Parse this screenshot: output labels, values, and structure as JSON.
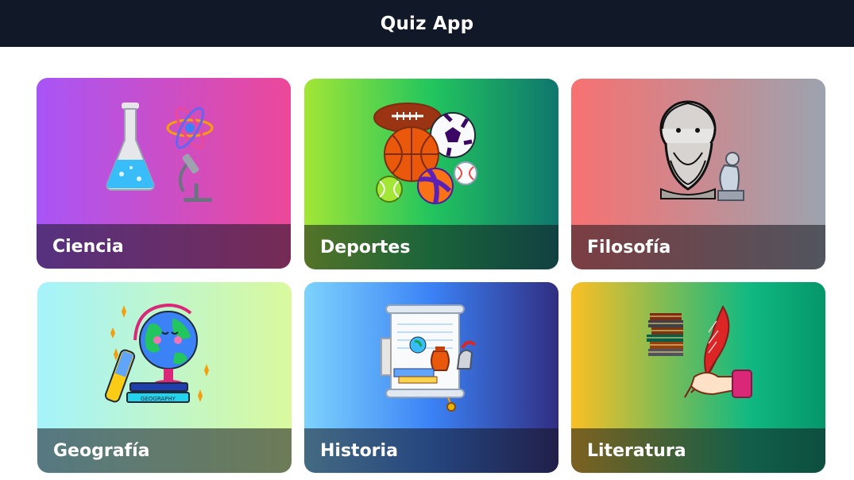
{
  "header": {
    "title": "Quiz App",
    "background": "#111827"
  },
  "categories": [
    {
      "label": "Ciencia",
      "icon": "science-flask-atom-microscope-icon"
    },
    {
      "label": "Deportes",
      "icon": "sports-balls-icon"
    },
    {
      "label": "Filosofía",
      "icon": "philosopher-bust-thinker-icon"
    },
    {
      "label": "Geografía",
      "icon": "globe-maps-books-icon"
    },
    {
      "label": "Historia",
      "icon": "scroll-history-artifacts-icon"
    },
    {
      "label": "Literatura",
      "icon": "books-quill-hand-icon"
    }
  ]
}
